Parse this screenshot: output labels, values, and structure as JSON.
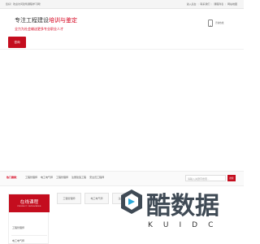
{
  "topbar": {
    "welcome": "您好！欢迎访问建筑课程学习网！",
    "links": [
      "进入后台",
      "联系我们",
      "课程列表",
      "网站地图"
    ]
  },
  "header": {
    "title_prefix": "专注工程建设",
    "title_highlight": "培训与鉴定",
    "slogan": "全力为社会输送更多专业职业人才",
    "phone_label": "咨询热线",
    "consult_button": "咨询"
  },
  "hot_search": {
    "label": "热门搜索：",
    "links": [
      "工程管理师",
      "电工电气师",
      "工程管理师",
      "注册建造工程",
      "安全员工程师"
    ],
    "placeholder": "请输入关键字搜索...",
    "button": "搜索"
  },
  "courses": {
    "title": "在线课程",
    "subtitle": "PRODUCT CATEGORIES",
    "items": [
      "工程管理师",
      "电工电气师"
    ],
    "tabs": [
      "工程管理师",
      "电工电气师",
      "注册建造师"
    ]
  },
  "watermark": {
    "text": "酷数据",
    "letters": [
      "K",
      "U",
      "I",
      "D",
      "C"
    ]
  },
  "colors": {
    "accent": "#c40d1e",
    "watermark": "#3f4a55"
  }
}
